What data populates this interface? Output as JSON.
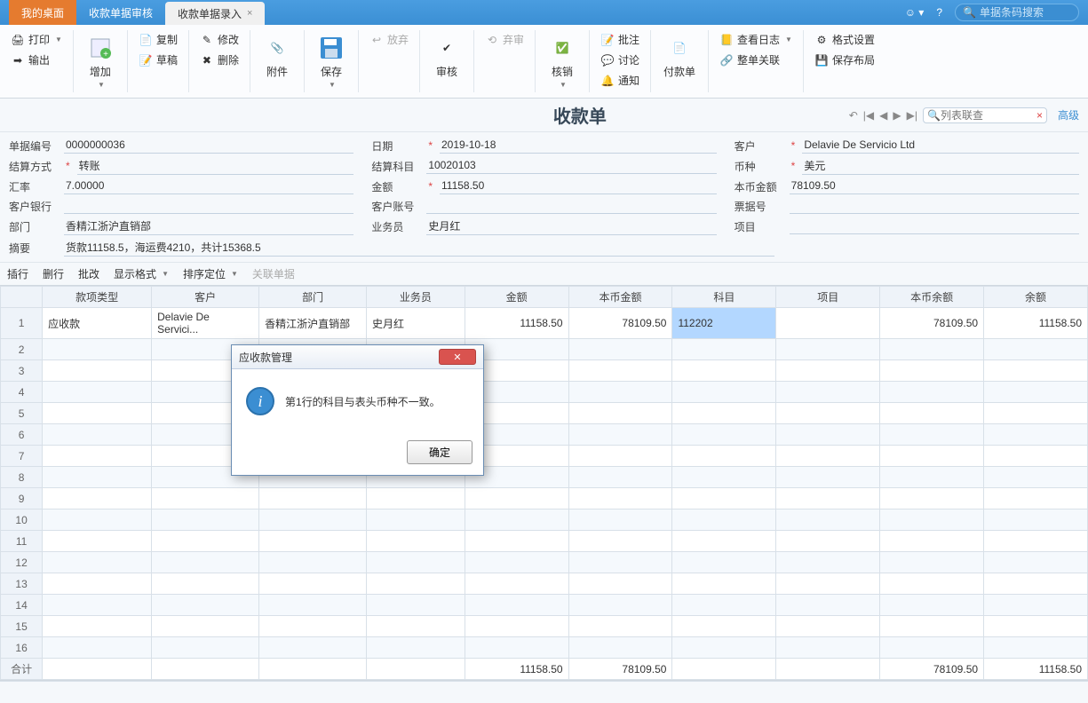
{
  "topbar": {
    "tabs": [
      {
        "label": "我的桌面",
        "type": "orange"
      },
      {
        "label": "收款单据审核",
        "type": "blue"
      },
      {
        "label": "收款单据录入",
        "type": "active"
      }
    ],
    "search_placeholder": "单据条码搜索"
  },
  "ribbon": {
    "print": "打印",
    "output": "输出",
    "add": "增加",
    "copy": "复制",
    "draft": "草稿",
    "modify": "修改",
    "delete": "删除",
    "attach": "附件",
    "save": "保存",
    "abandon": "放弃",
    "audit": "审核",
    "deaudit": "弃审",
    "verify": "核销",
    "batch_ann": "批注",
    "discuss": "讨论",
    "notify": "通知",
    "pay_bill": "付款单",
    "view_log": "查看日志",
    "whole_link": "整单关联",
    "format_set": "格式设置",
    "save_layout": "保存布局"
  },
  "titlebar": {
    "title": "收款单",
    "list_search_placeholder": "列表联查",
    "advanced": "高级"
  },
  "form": {
    "doc_no_label": "单据编号",
    "doc_no": "0000000036",
    "date_label": "日期",
    "date": "2019-10-18",
    "customer_label": "客户",
    "customer": "Delavie De Servicio Ltd",
    "settle_type_label": "结算方式",
    "settle_type": "转账",
    "settle_subj_label": "结算科目",
    "settle_subj": "10020103",
    "currency_label": "币种",
    "currency": "美元",
    "rate_label": "汇率",
    "rate": "7.00000",
    "amount_label": "金额",
    "amount": "11158.50",
    "local_amount_label": "本币金额",
    "local_amount": "78109.50",
    "cust_bank_label": "客户银行",
    "cust_acct_label": "客户账号",
    "note_no_label": "票据号",
    "dept_label": "部门",
    "dept": "香精江浙沪直销部",
    "operator_label": "业务员",
    "operator": "史月红",
    "project_label": "项目",
    "summary_label": "摘要",
    "summary": "货款11158.5，海运费4210，共计15368.5"
  },
  "toolbar": {
    "insert_row": "插行",
    "delete_row": "删行",
    "batch_mod": "批改",
    "display_fmt": "显示格式",
    "sort_pos": "排序定位",
    "link_doc": "关联单据"
  },
  "grid": {
    "cols": [
      "",
      "款项类型",
      "客户",
      "部门",
      "业务员",
      "金额",
      "本币金额",
      "科目",
      "项目",
      "本币余额",
      "余额"
    ],
    "rows": [
      {
        "n": "1",
        "type": "应收款",
        "cust": "Delavie De Servici...",
        "dept": "香精江浙沪直销部",
        "op": "史月红",
        "amt": "11158.50",
        "lamt": "78109.50",
        "subj": "112202",
        "proj": "",
        "lbal": "78109.50",
        "bal": "11158.50"
      }
    ],
    "empty_rows": 15,
    "total_label": "合计",
    "total_amt": "11158.50",
    "total_lamt": "78109.50",
    "total_lbal": "78109.50",
    "total_bal": "11158.50"
  },
  "dialog": {
    "title": "应收款管理",
    "message": "第1行的科目与表头币种不一致。",
    "ok": "确定"
  }
}
